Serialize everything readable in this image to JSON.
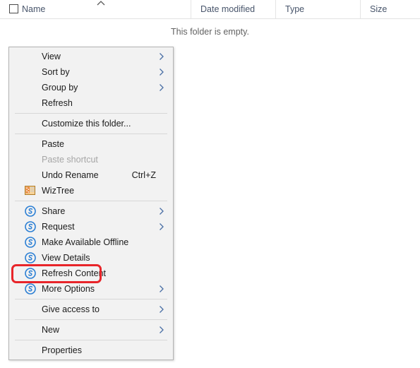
{
  "file_list": {
    "columns": [
      {
        "id": "name",
        "label": "Name"
      },
      {
        "id": "date_modified",
        "label": "Date modified"
      },
      {
        "id": "type",
        "label": "Type"
      },
      {
        "id": "size",
        "label": "Size"
      }
    ],
    "sort_indicator": "caret-up-icon",
    "select_all_checked": false,
    "empty_message": "This folder is empty.",
    "rows": []
  },
  "context_menu": {
    "groups": [
      {
        "items": [
          {
            "label": "View",
            "icon": null,
            "submenu": true,
            "accel": "",
            "disabled": false
          },
          {
            "label": "Sort by",
            "icon": null,
            "submenu": true,
            "accel": "",
            "disabled": false
          },
          {
            "label": "Group by",
            "icon": null,
            "submenu": true,
            "accel": "",
            "disabled": false
          },
          {
            "label": "Refresh",
            "icon": null,
            "submenu": false,
            "accel": "",
            "disabled": false
          }
        ]
      },
      {
        "items": [
          {
            "label": "Customize this folder...",
            "icon": null,
            "submenu": false,
            "accel": "",
            "disabled": false
          }
        ]
      },
      {
        "items": [
          {
            "label": "Paste",
            "icon": null,
            "submenu": false,
            "accel": "",
            "disabled": false
          },
          {
            "label": "Paste shortcut",
            "icon": null,
            "submenu": false,
            "accel": "",
            "disabled": true
          },
          {
            "label": "Undo Rename",
            "icon": null,
            "submenu": false,
            "accel": "Ctrl+Z",
            "disabled": false
          },
          {
            "label": "WizTree",
            "icon": "wiztree-icon",
            "submenu": false,
            "accel": "",
            "disabled": false
          }
        ]
      },
      {
        "items": [
          {
            "label": "Share",
            "icon": "sync-s-icon",
            "submenu": true,
            "accel": "",
            "disabled": false
          },
          {
            "label": "Request",
            "icon": "sync-s-icon",
            "submenu": true,
            "accel": "",
            "disabled": false
          },
          {
            "label": "Make Available Offline",
            "icon": "sync-s-icon",
            "submenu": false,
            "accel": "",
            "disabled": false
          },
          {
            "label": "View Details",
            "icon": "sync-s-icon",
            "submenu": false,
            "accel": "",
            "disabled": false
          },
          {
            "label": "Refresh Content",
            "icon": "sync-s-icon",
            "submenu": false,
            "accel": "",
            "disabled": false,
            "highlighted": true
          },
          {
            "label": "More Options",
            "icon": "sync-s-icon",
            "submenu": true,
            "accel": "",
            "disabled": false
          }
        ]
      },
      {
        "items": [
          {
            "label": "Give access to",
            "icon": null,
            "submenu": true,
            "accel": "",
            "disabled": false
          }
        ]
      },
      {
        "items": [
          {
            "label": "New",
            "icon": null,
            "submenu": true,
            "accel": "",
            "disabled": false
          }
        ]
      },
      {
        "items": [
          {
            "label": "Properties",
            "icon": null,
            "submenu": false,
            "accel": "",
            "disabled": false
          }
        ]
      }
    ]
  },
  "annotation": {
    "highlight_target": "Refresh Content",
    "highlight_color": "#e8252a"
  }
}
